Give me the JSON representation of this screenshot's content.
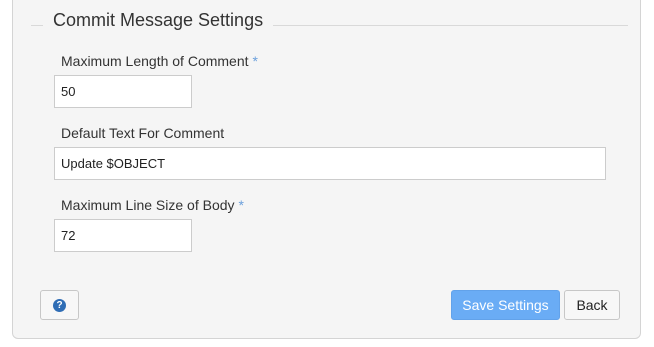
{
  "section": {
    "title": "Commit Message Settings"
  },
  "fields": {
    "max_length": {
      "label": "Maximum Length of Comment",
      "required_marker": "*",
      "value": "50"
    },
    "default_text": {
      "label": "Default Text For Comment",
      "value": "Update $OBJECT"
    },
    "max_line_size": {
      "label": "Maximum Line Size of Body",
      "required_marker": "*",
      "value": "72"
    }
  },
  "buttons": {
    "help_icon_glyph": "?",
    "save_label": "Save Settings",
    "back_label": "Back"
  },
  "colors": {
    "accent": "#6aacf5",
    "required_marker": "#6a9fdc",
    "help_icon": "#2f6db5"
  },
  "icons": {
    "help": "question-circle-icon"
  }
}
